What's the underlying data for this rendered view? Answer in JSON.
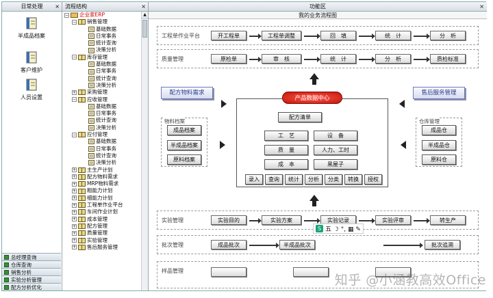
{
  "left_panel": {
    "title": "日常处理",
    "close": "×",
    "tools": [
      {
        "label": "半成品档案",
        "icon": "notebook-icon"
      },
      {
        "label": "客户维护",
        "icon": "notebook-icon"
      },
      {
        "label": "人员设置",
        "icon": "notebook-icon"
      }
    ],
    "nav": [
      "总经理查询",
      "仓库查询",
      "销售分析",
      "实验分析管理",
      "配方分析优化"
    ]
  },
  "tree_panel": {
    "title": "流程结构",
    "close": "×",
    "root": "企业家ERP",
    "nodes": [
      {
        "label": "销售管理",
        "level": 1,
        "sign": "−"
      },
      {
        "label": "基础数据",
        "level": 2
      },
      {
        "label": "日常事务",
        "level": 2
      },
      {
        "label": "统计查询",
        "level": 2
      },
      {
        "label": "决策分析",
        "level": 2
      },
      {
        "label": "库存管理",
        "level": 1,
        "sign": "−"
      },
      {
        "label": "基础数据",
        "level": 2
      },
      {
        "label": "日常事务",
        "level": 2
      },
      {
        "label": "统计查询",
        "level": 2
      },
      {
        "label": "决策分析",
        "level": 2
      },
      {
        "label": "采购管理",
        "level": 1,
        "sign": "+"
      },
      {
        "label": "应收管理",
        "level": 1,
        "sign": "−"
      },
      {
        "label": "基础数据",
        "level": 2
      },
      {
        "label": "日常事务",
        "level": 2
      },
      {
        "label": "统计查询",
        "level": 2
      },
      {
        "label": "决策分析",
        "level": 2
      },
      {
        "label": "应付管理",
        "level": 1,
        "sign": "−"
      },
      {
        "label": "基础数据",
        "level": 2
      },
      {
        "label": "日常事务",
        "level": 2
      },
      {
        "label": "统计查询",
        "level": 2
      },
      {
        "label": "决策分析",
        "level": 2
      },
      {
        "label": "主生产计划",
        "level": 1,
        "sign": "+"
      },
      {
        "label": "配方物料需求",
        "level": 1,
        "sign": "+"
      },
      {
        "label": "MRP物料需求",
        "level": 1,
        "sign": "+"
      },
      {
        "label": "粗能力计划",
        "level": 1,
        "sign": "+"
      },
      {
        "label": "细能力计划",
        "level": 1,
        "sign": "+"
      },
      {
        "label": "工程单作业平台",
        "level": 1,
        "sign": "+"
      },
      {
        "label": "车间作业计划",
        "level": 1,
        "sign": "+"
      },
      {
        "label": "成本管理",
        "level": 1,
        "sign": "+"
      },
      {
        "label": "配方管理",
        "level": 1,
        "sign": "+"
      },
      {
        "label": "质量管理",
        "level": 1,
        "sign": "+"
      },
      {
        "label": "实验管理",
        "level": 1,
        "sign": "+"
      },
      {
        "label": "售后服务管理",
        "level": 1,
        "sign": "+"
      }
    ]
  },
  "main": {
    "title": "功能区",
    "close": "×",
    "canvas_title": "我的业务流程图",
    "rows": [
      {
        "label": "工程单作业平台",
        "buttons": [
          "开工程单",
          "工程单调整",
          "回　填",
          "统　计",
          "分　析"
        ]
      },
      {
        "label": "质量管理",
        "buttons": [
          "原检单",
          "审　核",
          "统　计",
          "分　析",
          "质检标准"
        ]
      },
      {
        "label": "实验管理",
        "buttons": [
          "实验目的",
          "实验方案",
          "实验记录",
          "实验评审",
          "转生产"
        ]
      },
      {
        "label": "批次管理",
        "buttons": [
          "成品批次",
          "半成品批次",
          "批次追溯"
        ]
      },
      {
        "label": "样品管理",
        "buttons": []
      }
    ],
    "left_tag": "配方物料需求",
    "right_tag": "售后服务管理",
    "left_group": {
      "label": "物料档案",
      "items": [
        "成品档案",
        "半成品档案",
        "原料档案"
      ]
    },
    "right_group": {
      "label": "仓库管理",
      "items": [
        "成品仓",
        "半成品仓",
        "原料仓"
      ]
    },
    "center": {
      "pill": "产品数据中心",
      "list": "配方清单",
      "grid": [
        "工　艺",
        "设　备",
        "质　量",
        "人力、工时",
        "成　本",
        "黑屋子"
      ],
      "bottom": [
        "录入",
        "查询",
        "统计",
        "分析",
        "分类",
        "转换",
        "授权"
      ]
    },
    "ime": {
      "s": "S",
      "chars": "五 ☽ °, ▦ ✎"
    },
    "watermark": "知乎 @小涵教高效Office"
  },
  "colors": {
    "accent_red": "#c4140a",
    "tag_blue": "#2b3f8f",
    "nav_green": "#3a8e3a"
  }
}
